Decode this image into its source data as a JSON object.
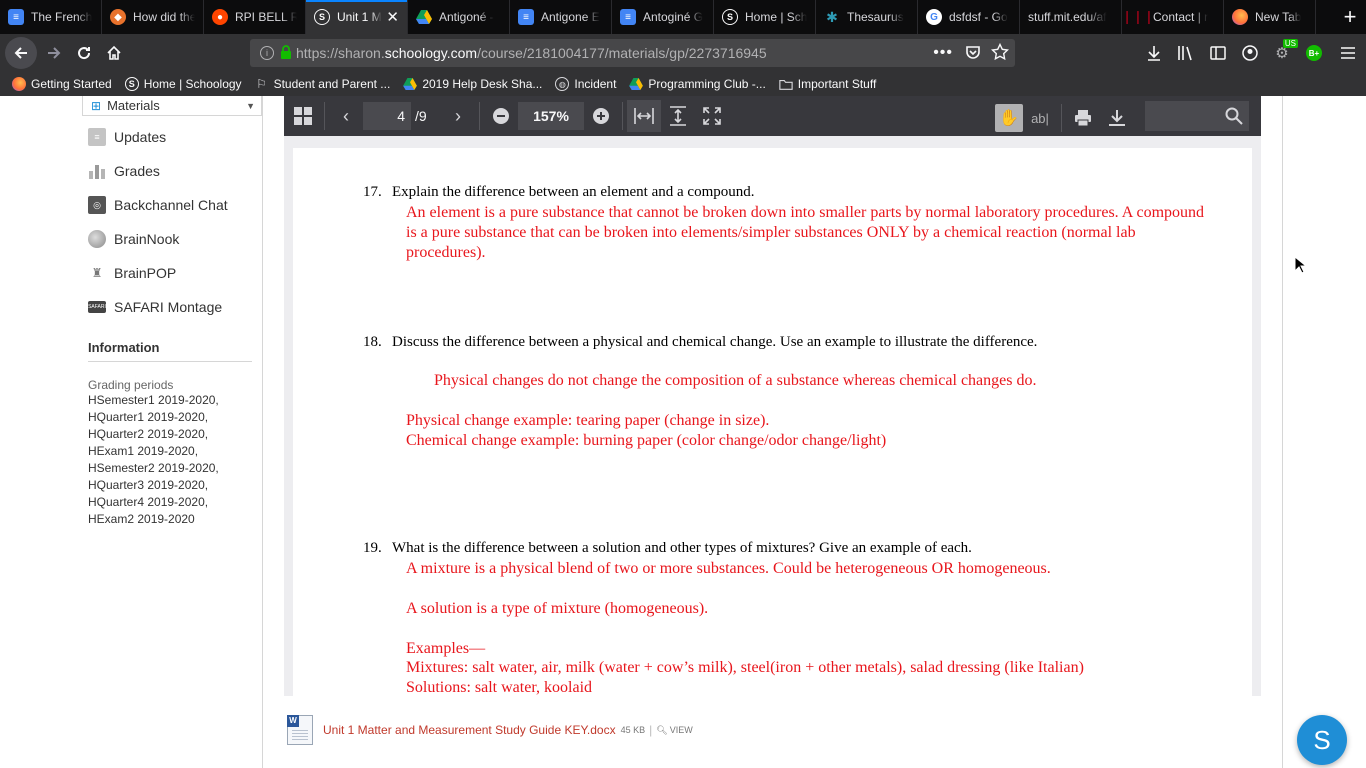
{
  "tabs": [
    {
      "title": "The French",
      "icon": "docs-icon",
      "color": "#4285f4",
      "active": false
    },
    {
      "title": "How did the",
      "icon": "brave-icon",
      "color": "#e8722c",
      "active": false
    },
    {
      "title": "RPI BELL R",
      "icon": "reddit-icon",
      "color": "#ff4500",
      "active": false
    },
    {
      "title": "Unit 1 M",
      "icon": "schoology-icon",
      "color": "#1f8ed6",
      "active": true
    },
    {
      "title": "Antigoné - ",
      "icon": "drive-icon",
      "color": "#fbbc04",
      "active": false
    },
    {
      "title": "Antigone E",
      "icon": "docs-icon",
      "color": "#4285f4",
      "active": false
    },
    {
      "title": "Antoginé G",
      "icon": "docs-icon",
      "color": "#4285f4",
      "active": false
    },
    {
      "title": "Home | Sch",
      "icon": "schoology-icon",
      "color": "#1f8ed6",
      "active": false
    },
    {
      "title": "Thesaurus",
      "icon": "thesaurus-icon",
      "color": "#2e9bb5",
      "active": false
    },
    {
      "title": "dsfdsf - Go",
      "icon": "google-icon",
      "color": "#4285f4",
      "active": false
    },
    {
      "title": "stuff.mit.edu/af",
      "icon": "none",
      "color": "#0c0c0d",
      "active": false
    },
    {
      "title": "Contact | r",
      "icon": "rpi-icon",
      "color": "#d6001c",
      "active": false
    },
    {
      "title": "New Tab",
      "icon": "firefox-icon",
      "color": "#ff7139",
      "active": false
    }
  ],
  "url": {
    "prefix": "https://sharon.",
    "domain": "schoology.com",
    "path": "/course/2181004177/materials/gp/2273716945"
  },
  "bookmarks": [
    {
      "label": "Getting Started",
      "icon": "firefox-icon"
    },
    {
      "label": "Home | Schoology",
      "icon": "schoology-icon"
    },
    {
      "label": "Student and Parent ...",
      "icon": "flag-icon"
    },
    {
      "label": "2019 Help Desk Sha...",
      "icon": "drive-icon"
    },
    {
      "label": "Incident",
      "icon": "globe-icon"
    },
    {
      "label": "Programming Club -...",
      "icon": "drive-icon"
    },
    {
      "label": "Important Stuff",
      "icon": "folder-icon"
    }
  ],
  "sidebar": {
    "materials_label": "Materials",
    "items": [
      {
        "label": "Updates",
        "icon": "updates-icon"
      },
      {
        "label": "Grades",
        "icon": "grades-icon"
      },
      {
        "label": "Backchannel Chat",
        "icon": "chat-icon"
      },
      {
        "label": "BrainNook",
        "icon": "brainnook-icon"
      },
      {
        "label": "BrainPOP",
        "icon": "brainpop-icon"
      },
      {
        "label": "SAFARI Montage",
        "icon": "safari-montage-icon"
      }
    ],
    "info_heading": "Information",
    "grading_label": "Grading periods",
    "periods": [
      "HSemester1 2019-2020,",
      "HQuarter1 2019-2020,",
      "HQuarter2 2019-2020,",
      "HExam1 2019-2020,",
      "HSemester2 2019-2020,",
      "HQuarter3 2019-2020,",
      "HQuarter4 2019-2020,",
      "HExam2 2019-2020"
    ]
  },
  "viewer": {
    "page": "4",
    "page_count": "/9",
    "zoom": "157%"
  },
  "doc": {
    "q17": {
      "num": "17.",
      "text": "Explain the difference between an element and a compound.",
      "answer": "An element is a pure substance that cannot be broken down into smaller parts by normal laboratory procedures. A compound is a pure substance that can be broken into elements/simpler substances ONLY by a chemical reaction (normal lab procedures)."
    },
    "q18": {
      "num": "18.",
      "text": "Discuss the difference between a physical and chemical change. Use an example to illustrate the difference.",
      "answer1": "Physical changes do not change the composition of a substance whereas chemical changes do.",
      "answer2": "Physical change example: tearing paper (change in size).",
      "answer3": "Chemical change example: burning paper (color change/odor change/light)"
    },
    "q19": {
      "num": "19.",
      "text": "What is the difference between a solution and other types of mixtures? Give an example of each.",
      "answer1": "A mixture is a physical blend of two or more substances. Could be heterogeneous OR homogeneous.",
      "answer2": "A solution is a type of mixture (homogeneous).",
      "answer3": "Examples—",
      "answer4": "Mixtures: salt water, air, milk  (water + cow’s milk), steel(iron + other metals), salad dressing (like Italian)",
      "answer5": "Solutions: salt water, koolaid"
    }
  },
  "attachment": {
    "filename": "Unit 1 Matter and Measurement Study Guide KEY.docx",
    "size": "45 KB",
    "view_label": "VIEW"
  },
  "fab_label": "S",
  "toolbar_badges": {
    "us": "US",
    "bplus": "B+"
  },
  "colors": {
    "answer_red": "#e8161c",
    "schoology_blue": "#1f8ed6",
    "tab_accent": "#0a84ff"
  }
}
